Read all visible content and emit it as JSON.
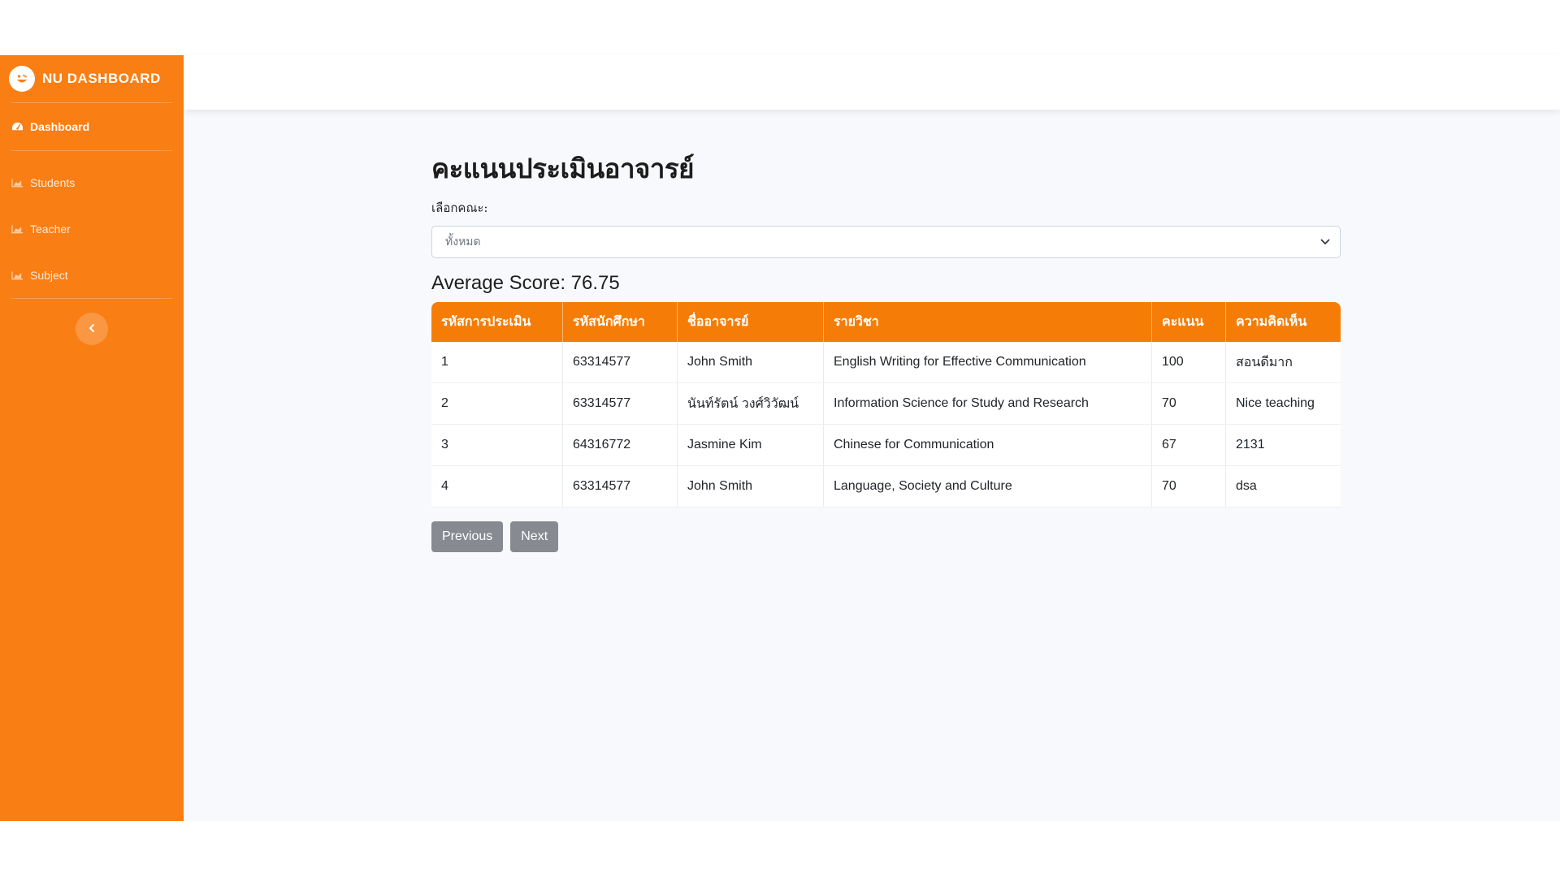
{
  "brand": {
    "name": "NU DASHBOARD",
    "logo_icon": "smiley-logo-icon"
  },
  "sidebar": {
    "items": [
      {
        "label": "Dashboard",
        "icon": "dashboard-gauge-icon",
        "active": true
      },
      {
        "label": "Students",
        "icon": "chart-area-icon"
      },
      {
        "label": "Teacher",
        "icon": "chart-area-icon"
      },
      {
        "label": "Subject",
        "icon": "chart-area-icon"
      }
    ],
    "toggle_icon": "chevron-left-icon"
  },
  "page": {
    "title": "คะแนนประเมินอาจารย์",
    "filter_label": "เลือกคณะ:",
    "filter_value": "ทั้งหมด",
    "average_score": "Average Score: 76.75"
  },
  "table": {
    "headers": [
      "รหัสการประเมิน",
      "รหัสนักศึกษา",
      "ชื่ออาจารย์",
      "รายวิชา",
      "คะแนน",
      "ความคิดเห็น"
    ],
    "rows": [
      [
        "1",
        "63314577",
        "John Smith",
        "English Writing for Effective Communication",
        "100",
        "สอนดีมาก"
      ],
      [
        "2",
        "63314577",
        "นันท์รัตน์ วงศ์วิวัฒน์",
        "Information Science for Study and Research",
        "70",
        "Nice teaching"
      ],
      [
        "3",
        "64316772",
        "Jasmine Kim",
        "Chinese for Communication",
        "67",
        "2131"
      ],
      [
        "4",
        "63314577",
        "John Smith",
        "Language, Society and Culture",
        "70",
        "dsa"
      ]
    ]
  },
  "pager": {
    "previous": "Previous",
    "next": "Next"
  },
  "colors": {
    "sidebar": "#f97e14",
    "table_header": "#f57d07",
    "button": "#888a91",
    "background": "#f8f9fc"
  }
}
